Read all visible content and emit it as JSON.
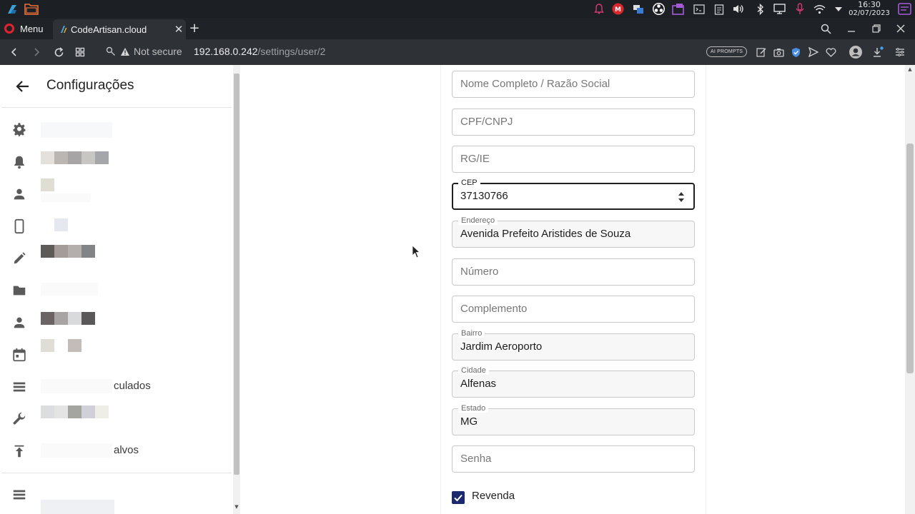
{
  "os": {
    "time": "16:30",
    "date": "02/07/2023",
    "tray_icons": [
      "notification-bell-icon",
      "mega-icon",
      "screen-share-icon",
      "obs-icon",
      "screenshot-icon",
      "terminal-icon",
      "clipboard-icon",
      "volume-icon",
      "bluetooth-icon",
      "display-icon",
      "microphone-icon",
      "wifi-icon",
      "tray-arrow-icon"
    ]
  },
  "browser": {
    "menu_label": "Menu",
    "tab_title": "CodeArtisan.cloud",
    "security_label": "Not secure",
    "url_host": "192.168.0.242",
    "url_path": "/settings/user/2",
    "ai_badge": "AI PROMPTS"
  },
  "sidebar": {
    "title": "Configurações",
    "items": [
      {
        "icon": "gear-icon"
      },
      {
        "icon": "bell-icon"
      },
      {
        "icon": "person-icon"
      },
      {
        "icon": "smartphone-icon"
      },
      {
        "icon": "pencil-icon"
      },
      {
        "icon": "folder-icon"
      },
      {
        "icon": "person-icon"
      },
      {
        "icon": "calendar-icon"
      },
      {
        "icon": "list-icon",
        "label_fragment": "culados"
      },
      {
        "icon": "wrench-icon"
      },
      {
        "icon": "upload-icon",
        "label_fragment": "alvos"
      },
      {
        "icon": "list-icon"
      }
    ]
  },
  "form": {
    "nome": {
      "placeholder": "Nome Completo / Razão Social",
      "value": ""
    },
    "cpf": {
      "placeholder": "CPF/CNPJ",
      "value": ""
    },
    "rg": {
      "placeholder": "RG/IE",
      "value": ""
    },
    "cep": {
      "label": "CEP",
      "value": "37130766"
    },
    "endereco": {
      "label": "Endereço",
      "value": "Avenida Prefeito Aristides de Souza"
    },
    "numero": {
      "placeholder": "Número",
      "value": ""
    },
    "complemento": {
      "placeholder": "Complemento",
      "value": ""
    },
    "bairro": {
      "label": "Bairro",
      "value": "Jardim Aeroporto"
    },
    "cidade": {
      "label": "Cidade",
      "value": "Alfenas"
    },
    "estado": {
      "label": "Estado",
      "value": "MG"
    },
    "senha": {
      "placeholder": "Senha",
      "value": ""
    },
    "revenda": {
      "label": "Revenda",
      "checked": true
    }
  },
  "colors": {
    "checkbox": "#1a2a6c",
    "os_bar": "#1c1f24",
    "browser_chrome": "#2e3136"
  }
}
